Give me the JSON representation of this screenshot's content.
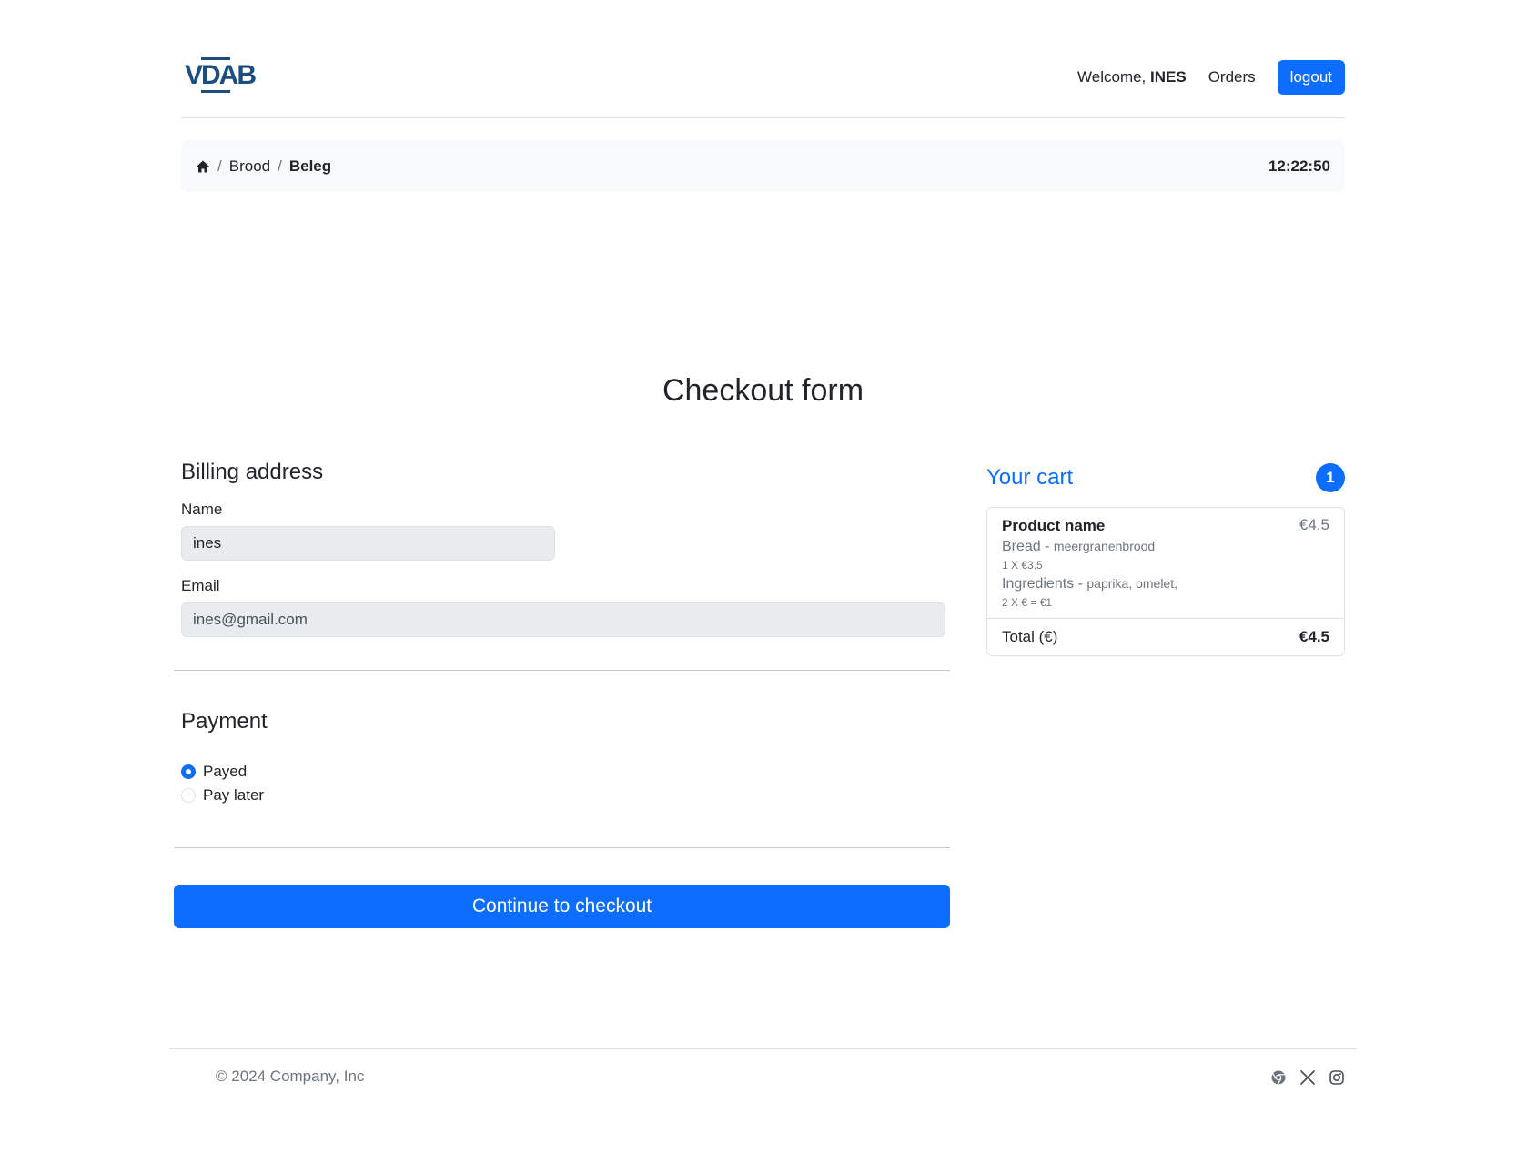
{
  "header": {
    "logo_text": "VDAB",
    "welcome_prefix": "Welcome,",
    "user_name": "INES",
    "orders_label": "Orders",
    "logout_label": "logout"
  },
  "breadcrumb": {
    "items": [
      "Brood",
      "Beleg"
    ],
    "separator": "/",
    "time": "12:22:50"
  },
  "page_title": "Checkout form",
  "billing": {
    "title": "Billing address",
    "name_label": "Name",
    "name_value": "ines",
    "email_label": "Email",
    "email_value": "ines@gmail.com"
  },
  "payment": {
    "title": "Payment",
    "options": [
      {
        "label": "Payed",
        "checked": true
      },
      {
        "label": "Pay later",
        "checked": false
      }
    ]
  },
  "checkout_button": "Continue to checkout",
  "cart": {
    "title": "Your cart",
    "count": "1",
    "items": [
      {
        "name": "Product name",
        "price": "€4.5",
        "bread_label": "Bread -",
        "bread_value": "meergranenbrood",
        "bread_qty": "1 X €3.5",
        "ingredients_label": "Ingredients -",
        "ingredients_value": "paprika, omelet,",
        "ingredients_qty": "2 X € = €1"
      }
    ],
    "total_label": "Total (€)",
    "total_value": "€4.5"
  },
  "footer": {
    "copyright": "© 2024 Company, Inc",
    "icons": [
      "chrome-icon",
      "x-icon",
      "instagram-icon"
    ]
  },
  "colors": {
    "primary": "#0d6efd",
    "logo": "#1b4d7e",
    "muted": "#6c757d"
  }
}
